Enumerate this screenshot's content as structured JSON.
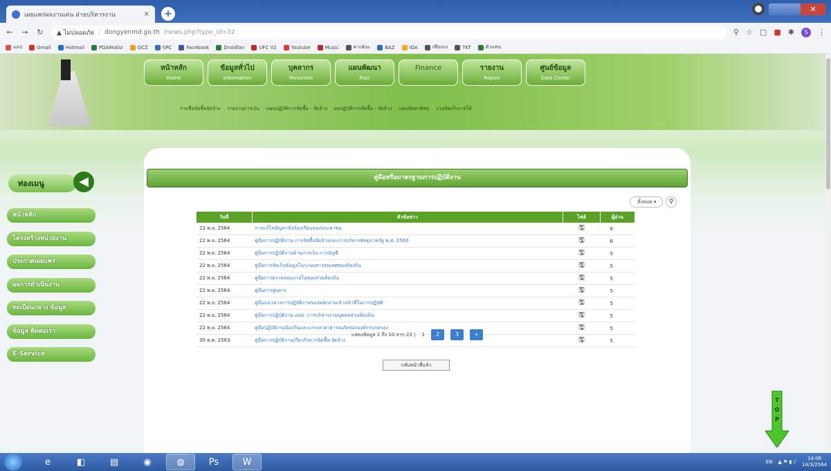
{
  "browser": {
    "tab_title": "เผยแพร่ผลงานเด่น ฝ่ายบริหารงาน",
    "tab_close": "×",
    "new_tab": "+",
    "url_warning": "▲ ไม่ปลอดภัย",
    "url_host": "dongyenmd.go.th",
    "url_path": "/news.php?type_id=32",
    "bookmarks": [
      {
        "label": "แอป",
        "color": "#d9534f"
      },
      {
        "label": "Gmail",
        "color": "#d93025"
      },
      {
        "label": "Hotmail",
        "color": "#1e73c9"
      },
      {
        "label": "PDAMobiz",
        "color": "#2c7a3b"
      },
      {
        "label": "OCZ",
        "color": "#f0a020"
      },
      {
        "label": "SPC",
        "color": "#3b6cb0"
      },
      {
        "label": "Facebook",
        "color": "#3b5998"
      },
      {
        "label": "Droidfan",
        "color": "#2e7d32"
      },
      {
        "label": "UFC V2",
        "color": "#c62828"
      },
      {
        "label": "Youtube",
        "color": "#e53935"
      },
      {
        "label": "Music",
        "color": "#c62828"
      },
      {
        "label": "คาเฟ่นะ",
        "color": "#555"
      },
      {
        "label": "BAZ",
        "color": "#2a6fb5"
      },
      {
        "label": "IOA",
        "color": "#f9a825"
      },
      {
        "label": "เซียงกง",
        "color": "#555"
      },
      {
        "label": "TKT",
        "color": "#555"
      },
      {
        "label": "ตัวแทน",
        "color": "#2e7d32"
      }
    ]
  },
  "site": {
    "menu": [
      {
        "th": "หน้าหลัก",
        "en": "Home"
      },
      {
        "th": "ข้อมูลทั่วไป",
        "en": "Information"
      },
      {
        "th": "บุคลากร",
        "en": "Personnel"
      },
      {
        "th": "แผนพัฒนา",
        "en": "Plan"
      },
      {
        "th": "Finance",
        "en": ""
      },
      {
        "th": "รายงาน",
        "en": "Report"
      },
      {
        "th": "ศูนย์ข้อมูล",
        "en": "Data Center"
      }
    ],
    "submenu": [
      "รายชื่อจัดซื้อจัดจ้าง",
      "รายงานการเงิน",
      "แผนปฏิบัติการจัดซื้อ - จัดจ้าง",
      "ผลปฏิบัติการจัดซื้อ - จัดจ้าง",
      "แผนจัดหาพัสดุ",
      "งานจัดเก็บรายได้"
    ],
    "sidebar_title": "ท่องเมนู",
    "sidebar_items": [
      "หน้าหลัก",
      "โครงสร้างหน่วยงาน",
      "ประกาศเผยแพร่",
      "ผลการดำเนินงาน",
      "ทะเบียนกลาง ข้อมูล",
      "ข้อมูล ติดต่อเรา",
      "E-Service"
    ],
    "content_title": "คู่มือหรือมาตรฐานการปฏิบัติงาน",
    "search_select": "ทั้งหมด",
    "table": {
      "headers": [
        "วันที่",
        "หัวข้อข่าว",
        "ไฟล์",
        "ผู้อ่าน"
      ],
      "rows": [
        {
          "date": "22 พ.ย. 2564",
          "title": "การแก้ไขปัญหาข้อร้องเรียนของประชาชน",
          "reads": "6"
        },
        {
          "date": "22 พ.ย. 2564",
          "title": "คู่มือการปฏิบัติงาน การจัดซื้อจัดจ้างและการบริหารพัสดุภาครัฐ พ.ศ. 2560",
          "reads": "6"
        },
        {
          "date": "22 พ.ย. 2564",
          "title": "คู่มือการปฏิบัติงานด้านการเงิน การบัญชี",
          "reads": "5"
        },
        {
          "date": "22 พ.ย. 2564",
          "title": "คู่มือการจัดเก็บข้อมูลในระบบสารสนเทศของท้องถิ่น",
          "reads": "5"
        },
        {
          "date": "22 พ.ย. 2564",
          "title": "คู่มือการตรวจสอบภายในของส่วนท้องถิ่น",
          "reads": "5"
        },
        {
          "date": "22 พ.ย. 2564",
          "title": "คู่มือการสูบยาง",
          "reads": "5"
        },
        {
          "date": "22 พ.ย. 2564",
          "title": "คู่มือแนวทางการปฏิบัติงานของพนักงานเจ้าหน้าที่ในการปฏิบัติ",
          "reads": "5"
        },
        {
          "date": "22 พ.ย. 2564",
          "title": "คู่มือการปฏิบัติงาน อปท. การบริหารงานบุคคลส่วนท้องถิ่น",
          "reads": "5"
        },
        {
          "date": "22 พ.ย. 2564",
          "title": "คู่มือปฏิบัติงานป้องกันและบรรเทาสาธารณภัยขององค์กรปกครอง",
          "reads": "5"
        },
        {
          "date": "30 ธ.ค. 2563",
          "title": "คู่มือการปฏิบัติงานเกี่ยวกับการจัดซื้อ-จัดจ้าง",
          "reads": "5"
        }
      ]
    },
    "pager_text": "แสดงข้อมูล 1 ถึง 10 จาก 22 |",
    "pager_current": "1",
    "pager_buttons": [
      "2",
      "3",
      "»"
    ],
    "back_button": "กลับหน้าที่แล้ว"
  },
  "taskbar": {
    "lang": "EN",
    "time": "14:08",
    "date": "14/3/2564"
  },
  "colors": {
    "green_dark": "#5aa127",
    "green_light": "#9ad06f",
    "link_blue": "#3a7ac9",
    "pager_blue": "#3d7fcc"
  }
}
